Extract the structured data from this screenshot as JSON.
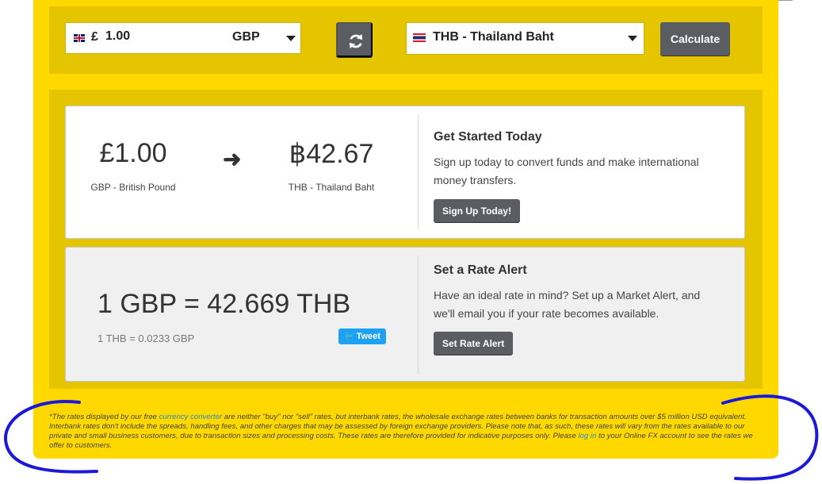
{
  "converter": {
    "amount_symbol": "£",
    "amount_value": "1.00",
    "amount_currency": "GBP",
    "amount_flag_icon": "uk-flag-icon",
    "target_currency": "THB - Thailand Baht",
    "target_flag_icon": "thailand-flag-icon",
    "swap_icon": "refresh-icon",
    "calculate_label": "Calculate"
  },
  "result": {
    "from_amount": "£1.00",
    "from_label": "GBP - British Pound",
    "arrow_icon": "arrow-right-icon",
    "to_amount": "฿42.67",
    "to_label": "THB - Thailand Baht"
  },
  "get_started": {
    "title": "Get Started Today",
    "text": "Sign up today to convert funds and make international money transfers.",
    "button": "Sign Up Today!"
  },
  "rate": {
    "main": "1 GBP = 42.669 THB",
    "inverse": "1 THB = 0.0233 GBP",
    "tweet": "Tweet",
    "tweet_icon": "twitter-bird-icon"
  },
  "alert": {
    "title": "Set a Rate Alert",
    "text": "Have an ideal rate in mind? Set up a Market Alert, and we'll email you if your rate becomes available.",
    "button": "Set Rate Alert"
  },
  "disclaimer": {
    "part1": "*The rates displayed by our free ",
    "link1": "currency converter",
    "part2": " are neither \"buy\" nor \"sell\" rates, but interbank rates, the wholesale exchange rates between banks for transaction amounts over $5 million USD equivalent. Interbank rates don't include the spreads, handling fees, and other charges that may be assessed by foreign exchange providers. Please note that, as such, these rates will vary from the rates available to our private and small business customers, due to transaction sizes and processing costs. These rates are therefore provided for indicative purposes only. Please ",
    "link2": "log in",
    "part3": " to your Online FX account to see the rates we offer to customers."
  },
  "colors": {
    "panel_bg": "#ffd800",
    "section_bg": "#e5c400",
    "button_bg": "#5a5e63",
    "annotation": "#1a1ad8",
    "tweet_bg": "#1da1f2"
  }
}
